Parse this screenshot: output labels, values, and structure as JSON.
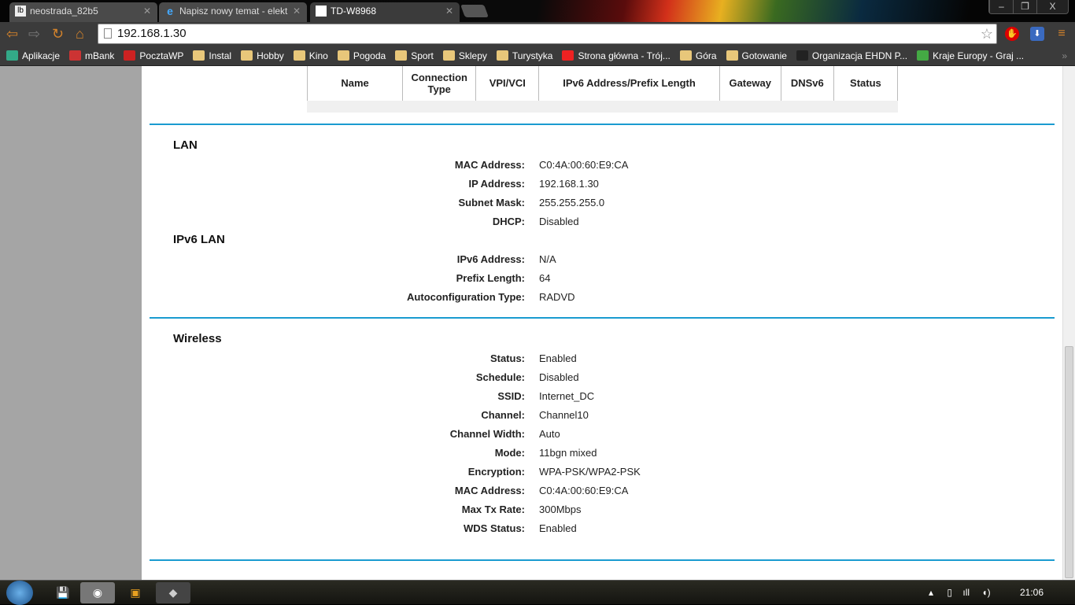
{
  "browser": {
    "tabs": [
      {
        "label": "neostrada_82b5",
        "icon": "livebox-icon"
      },
      {
        "label": "Napisz nowy temat - elekt",
        "icon": "ie-icon"
      },
      {
        "label": "TD-W8968",
        "icon": "page-icon",
        "active": true
      }
    ],
    "url": "192.168.1.30",
    "window_buttons": [
      "–",
      "❐",
      "X"
    ],
    "bookmarks": [
      {
        "label": "Aplikacje",
        "icon": "apps-icon"
      },
      {
        "label": "mBank",
        "icon": "mbank-icon"
      },
      {
        "label": "PocztaWP",
        "icon": "wp-icon"
      },
      {
        "label": "Instal",
        "icon": "folder-icon"
      },
      {
        "label": "Hobby",
        "icon": "folder-icon"
      },
      {
        "label": "Kino",
        "icon": "folder-icon"
      },
      {
        "label": "Pogoda",
        "icon": "folder-icon"
      },
      {
        "label": "Sport",
        "icon": "folder-icon"
      },
      {
        "label": "Sklepy",
        "icon": "folder-icon"
      },
      {
        "label": "Turystyka",
        "icon": "folder-icon"
      },
      {
        "label": "Strona główna - Trój...",
        "icon": "trojka-icon"
      },
      {
        "label": "Góra",
        "icon": "folder-icon"
      },
      {
        "label": "Gotowanie",
        "icon": "folder-icon"
      },
      {
        "label": "Organizacja EHDN P...",
        "icon": "joomla-icon"
      },
      {
        "label": "Kraje Europy - Graj ...",
        "icon": "palm-icon"
      }
    ],
    "more": "»"
  },
  "table": {
    "headers": [
      "Name",
      "Connection Type",
      "VPI/VCI",
      "IPv6 Address/Prefix Length",
      "Gateway",
      "DNSv6",
      "Status"
    ]
  },
  "lan": {
    "title": "LAN",
    "rows": [
      {
        "label": "MAC Address:",
        "value": "C0:4A:00:60:E9:CA"
      },
      {
        "label": "IP Address:",
        "value": "192.168.1.30"
      },
      {
        "label": "Subnet Mask:",
        "value": "255.255.255.0"
      },
      {
        "label": "DHCP:",
        "value": "Disabled"
      }
    ]
  },
  "ipv6lan": {
    "title": "IPv6 LAN",
    "rows": [
      {
        "label": "IPv6 Address:",
        "value": "N/A"
      },
      {
        "label": "Prefix Length:",
        "value": "64"
      },
      {
        "label": "Autoconfiguration Type:",
        "value": "RADVD"
      }
    ]
  },
  "wireless": {
    "title": "Wireless",
    "rows": [
      {
        "label": "Status:",
        "value": "Enabled"
      },
      {
        "label": "Schedule:",
        "value": "Disabled"
      },
      {
        "label": "SSID:",
        "value": "Internet_DC"
      },
      {
        "label": "Channel:",
        "value": "Channel10"
      },
      {
        "label": "Channel Width:",
        "value": "Auto"
      },
      {
        "label": "Mode:",
        "value": "11bgn mixed"
      },
      {
        "label": "Encryption:",
        "value": "WPA-PSK/WPA2-PSK"
      },
      {
        "label": "MAC Address:",
        "value": "C0:4A:00:60:E9:CA"
      },
      {
        "label": "Max Tx Rate:",
        "value": "300Mbps"
      },
      {
        "label": "WDS Status:",
        "value": "Enabled"
      }
    ]
  },
  "taskbar": {
    "clock": "21:06"
  },
  "colors": {
    "accent": "#1a9bd0"
  }
}
